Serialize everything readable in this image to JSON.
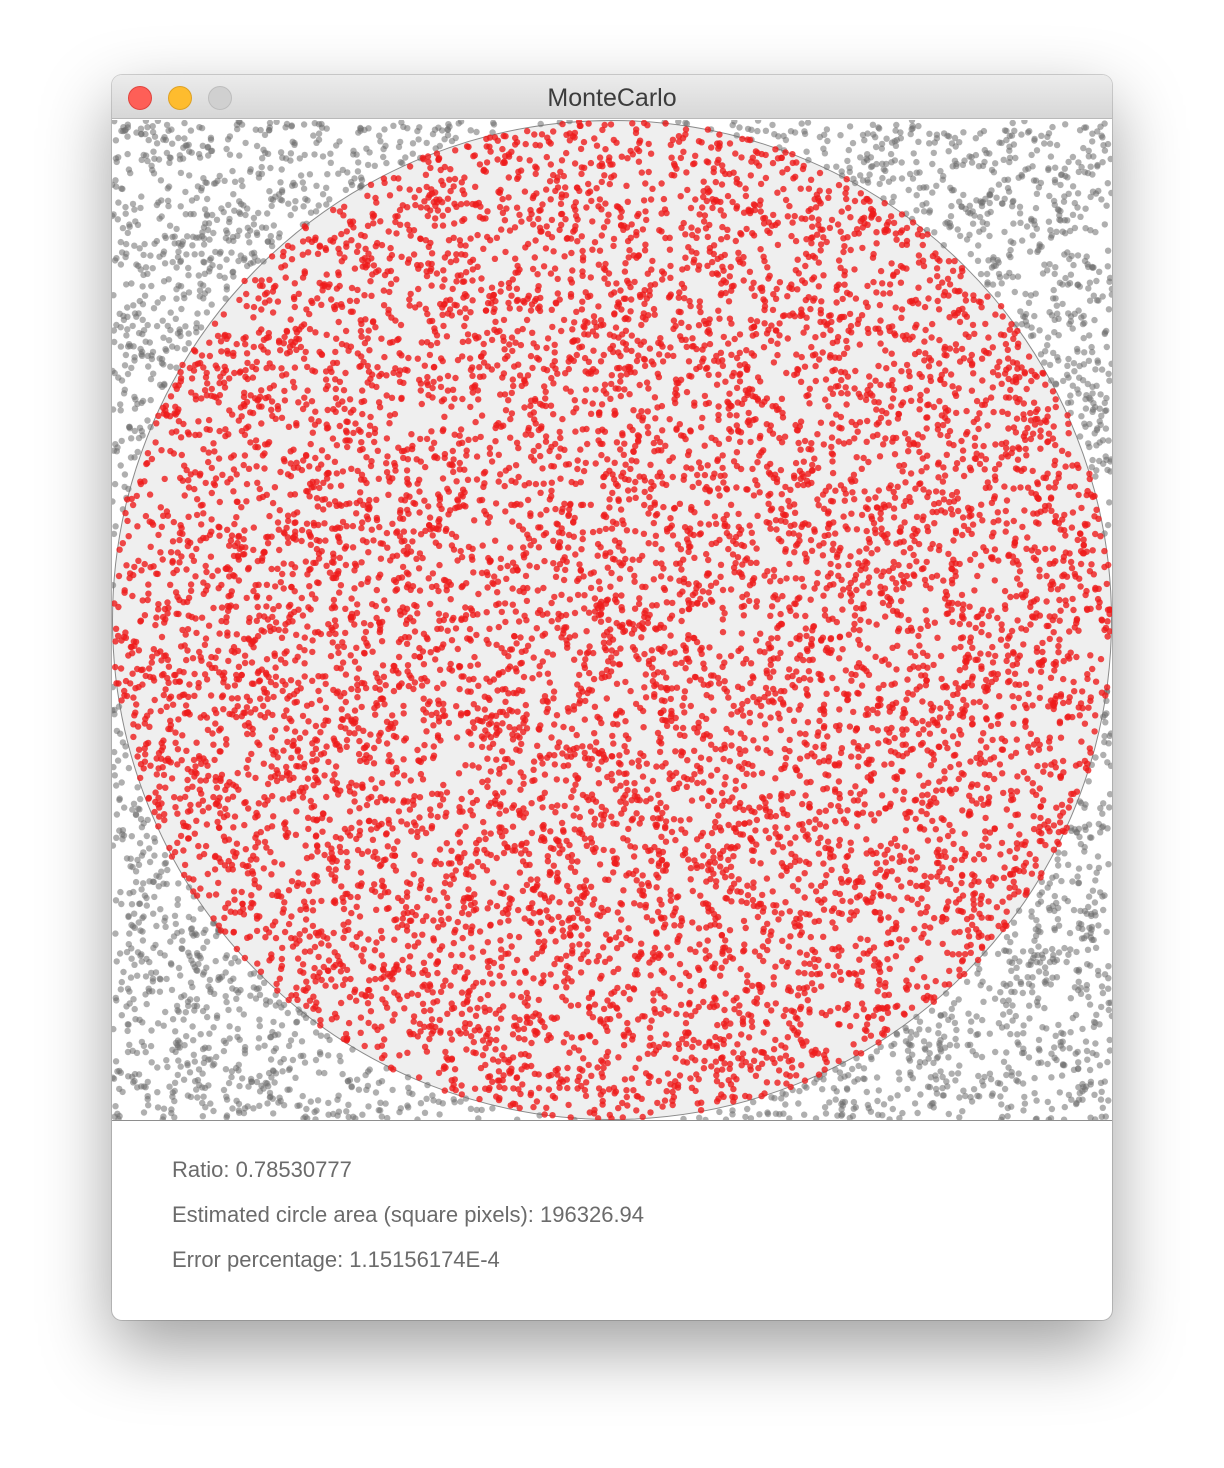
{
  "window": {
    "title": "MonteCarlo"
  },
  "results": {
    "ratio": "Ratio: 0.78530777",
    "estimated_area": "Estimated circle area (square pixels): 196326.94",
    "error_percentage": "Error percentage: 1.15156174E-4"
  },
  "colors": {
    "inside_point": "#ee1c1c",
    "outside_point": "#6e6e6e",
    "circle_fill": "#efefef",
    "circle_stroke": "#8a8a8a"
  }
}
